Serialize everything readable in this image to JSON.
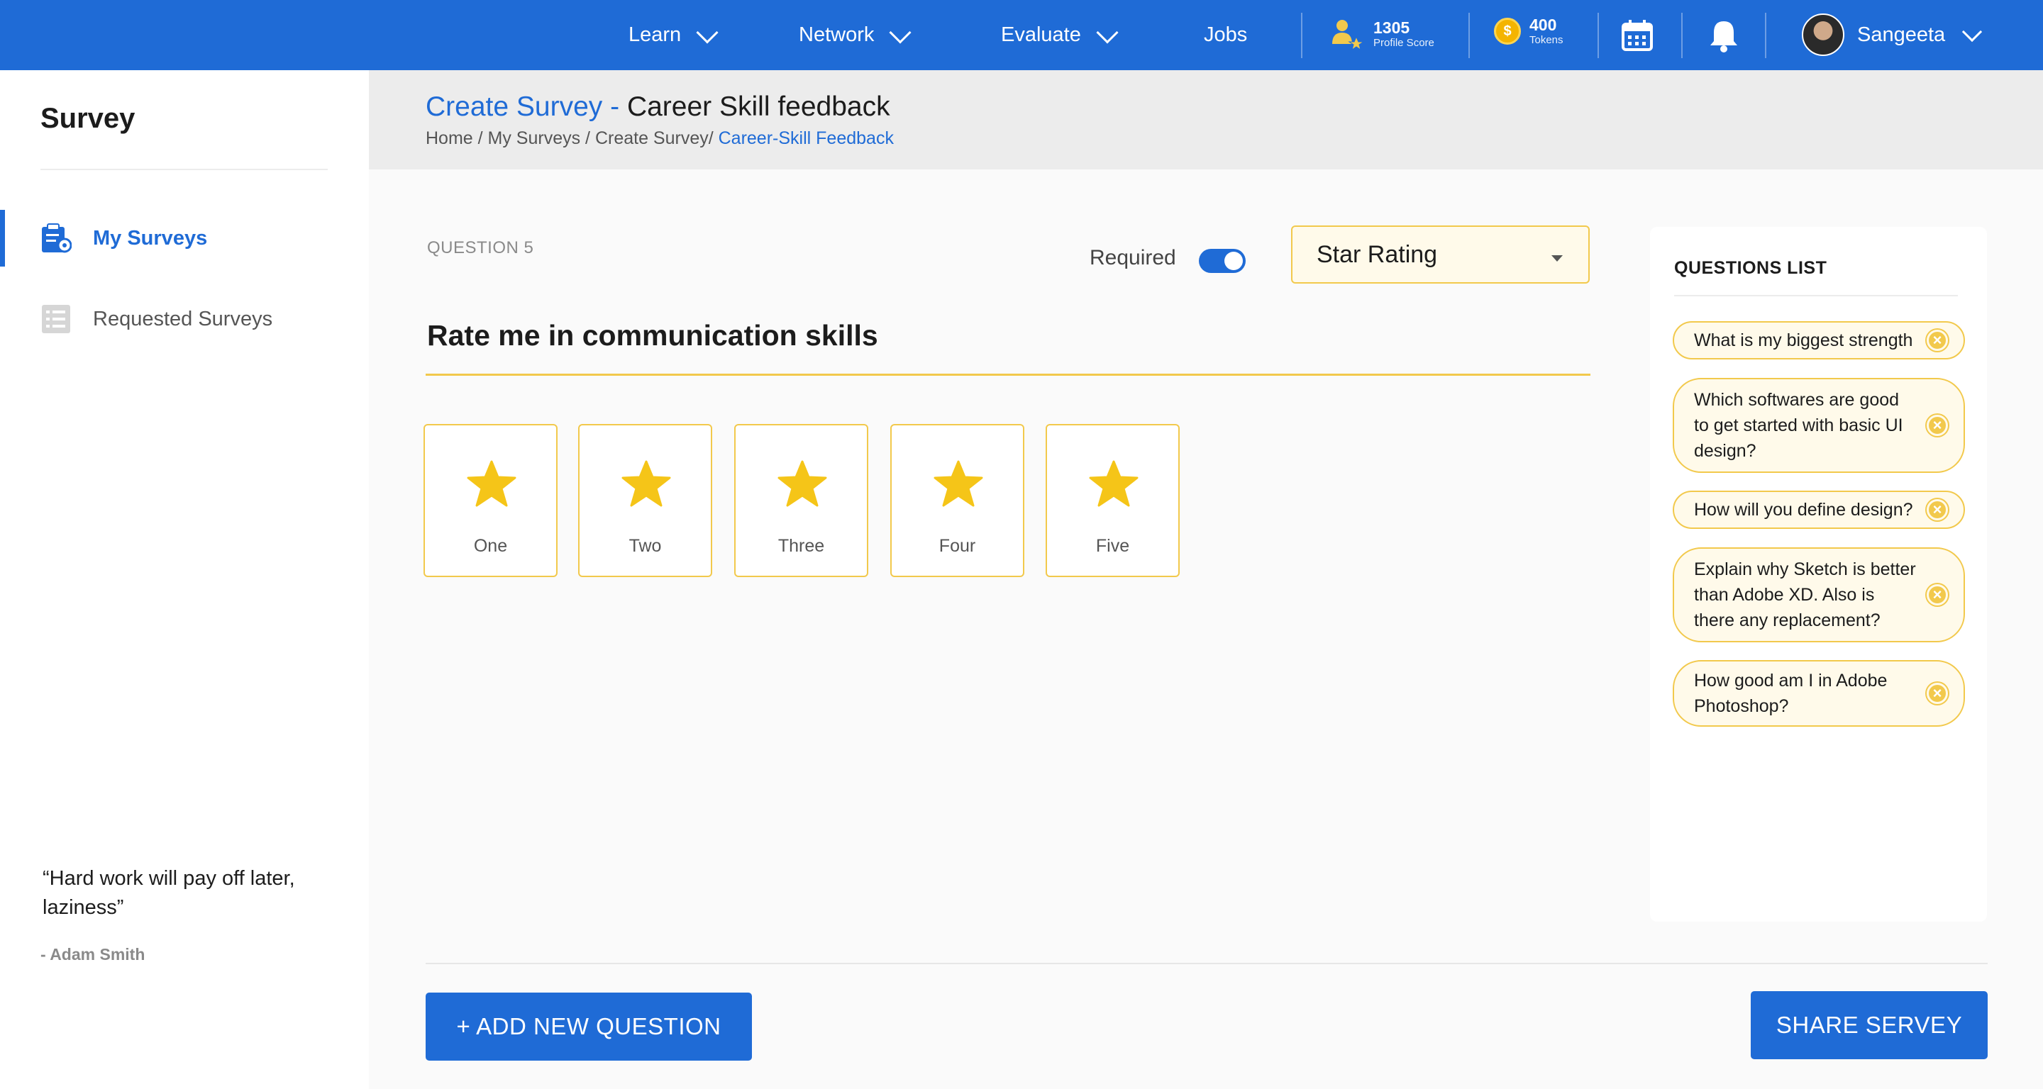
{
  "nav": {
    "items": [
      {
        "label": "Learn"
      },
      {
        "label": "Network"
      },
      {
        "label": "Evaluate"
      },
      {
        "label": "Jobs"
      }
    ],
    "profile_score": {
      "value": "1305",
      "label": "Profile Score"
    },
    "tokens": {
      "value": "400",
      "label": "Tokens",
      "coin_symbol": "$"
    },
    "user_name": "Sangeeta",
    "icons": [
      "profile-score-icon",
      "token-coin-icon",
      "calendar-icon",
      "bell-icon",
      "chevron-down-icon"
    ]
  },
  "sidebar": {
    "title": "Survey",
    "items": [
      {
        "label": "My Surveys",
        "active": true,
        "icon": "survey-clipboard-icon"
      },
      {
        "label": "Requested Surveys",
        "active": false,
        "icon": "list-document-icon"
      }
    ],
    "quote": "“Hard work will pay off later, laziness”",
    "quote_author": "- Adam Smith"
  },
  "header": {
    "title_accent": "Create Survey - ",
    "title_rest": "Career Skill feedback",
    "breadcrumb": {
      "trail": "Home / My Surveys / Create Survey/ ",
      "current": "Career-Skill Feedback"
    }
  },
  "question": {
    "number_label": "QUESTION 5",
    "required_label": "Required",
    "required_on": true,
    "type_selected": "Star Rating",
    "text": "Rate me in communication skills",
    "options": [
      "One",
      "Two",
      "Three",
      "Four",
      "Five"
    ]
  },
  "questions_list": {
    "title": "QUESTIONS LIST",
    "items": [
      "What is my biggest strength",
      "Which softwares are good to get started with basic UI design?",
      "How will you define design?",
      "Explain why Sketch is better than Adobe XD. Also is there any replacement?",
      "How good am I in Adobe Photoshop?"
    ]
  },
  "actions": {
    "add_label": "+ ADD NEW QUESTION",
    "share_label": "SHARE SERVEY"
  },
  "colors": {
    "primary": "#1f6bd6",
    "accent": "#f2c94c",
    "chip_bg": "#fffaea",
    "star": "#f5c518"
  }
}
